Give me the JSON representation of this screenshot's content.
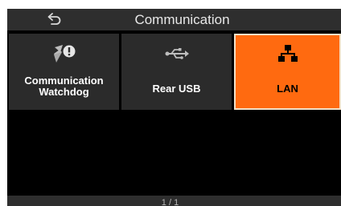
{
  "header": {
    "title": "Communication",
    "back_icon": "back-arrow-icon"
  },
  "tiles": [
    {
      "label": "Communication\nWatchdog",
      "icon": "watchdog-alert-icon",
      "selected": false
    },
    {
      "label": "Rear USB",
      "icon": "usb-icon",
      "selected": false
    },
    {
      "label": "LAN",
      "icon": "network-icon",
      "selected": true
    }
  ],
  "footer": {
    "page": "1 / 1"
  },
  "colors": {
    "panel_bg": "#000000",
    "bar_bg": "#2e2e2e",
    "tile_bg": "#2b2b2b",
    "accent": "#ff6a10",
    "accent_border": "#f3e1c8"
  }
}
